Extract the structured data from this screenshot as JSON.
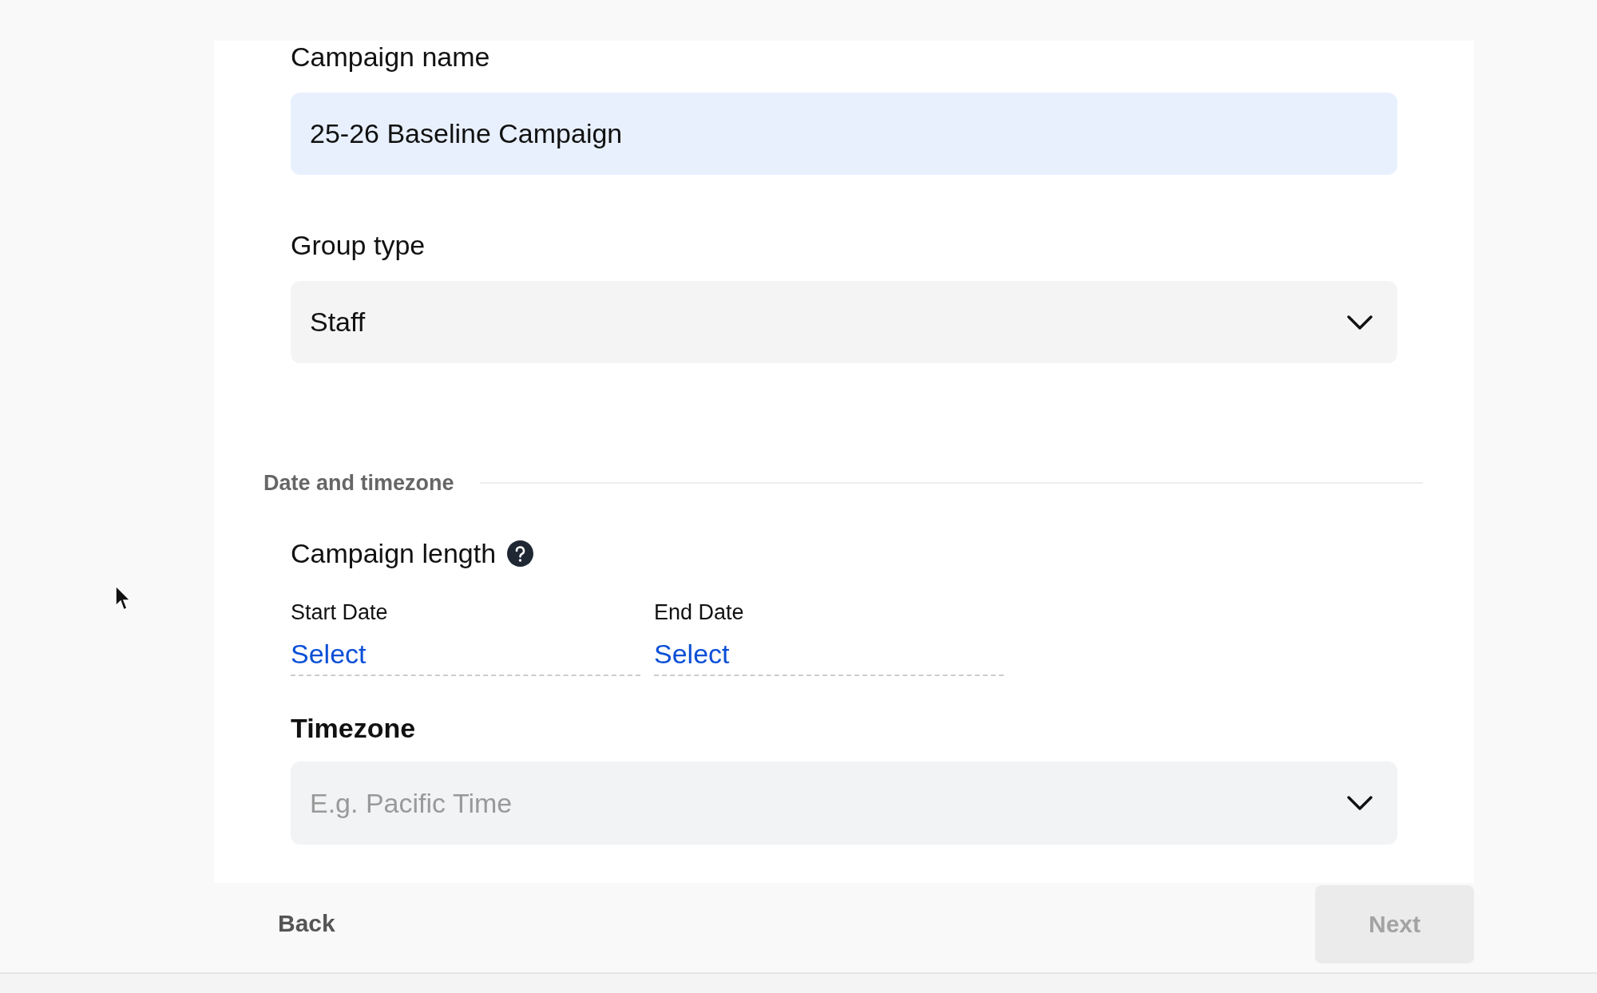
{
  "fields": [
    {
      "kind": "text",
      "label": "Campaign name",
      "value": "25-26 Baseline Campaign"
    },
    {
      "kind": "select",
      "label": "Group type",
      "value": "Staff"
    }
  ],
  "section": {
    "title": "Date and timezone"
  },
  "campaign_length": {
    "label": "Campaign length",
    "dates": [
      {
        "label": "Start Date",
        "value": "Select"
      },
      {
        "label": "End Date",
        "value": "Select"
      }
    ]
  },
  "timezone": {
    "label": "Timezone",
    "placeholder": "E.g. Pacific Time"
  },
  "footer": {
    "back": "Back",
    "next": {
      "label": "Next",
      "disabled": true
    }
  }
}
